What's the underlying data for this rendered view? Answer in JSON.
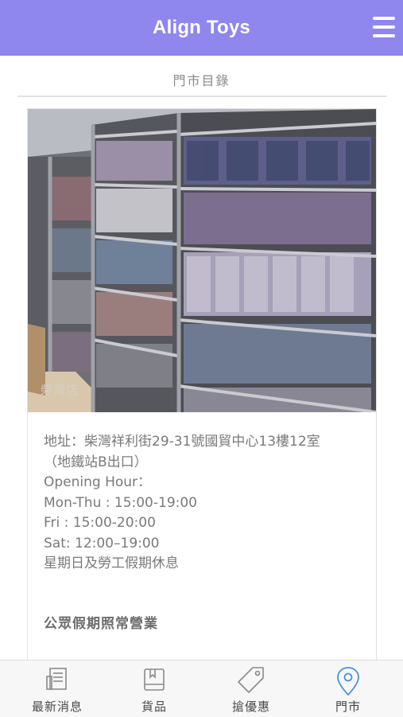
{
  "header": {
    "title": "Align Toys",
    "menu_icon": "hamburger-menu-icon",
    "color": "#8f86ee"
  },
  "section": {
    "title": "門市目錄"
  },
  "store": {
    "photo_watermark": "柴灣店",
    "address_line1": "地址：柴灣祥利街29-31號國貿中心13樓12室",
    "address_line2": "（地鐵站B出口）",
    "hours_heading": "Opening Hour：",
    "hours": [
      "Mon-Thu : 15:00-19:00",
      "Fri : 15:00-20:00",
      "Sat: 12:00–19:00",
      "星期日及勞工假期休息"
    ],
    "holiday_note": "公眾假期照常營業"
  },
  "tabbar": {
    "active_color": "#4a90e2",
    "items": [
      {
        "label": "最新消息",
        "icon": "news-icon"
      },
      {
        "label": "貨品",
        "icon": "book-icon"
      },
      {
        "label": "搶優惠",
        "icon": "tag-icon"
      },
      {
        "label": "門市",
        "icon": "location-pin-icon"
      }
    ]
  }
}
